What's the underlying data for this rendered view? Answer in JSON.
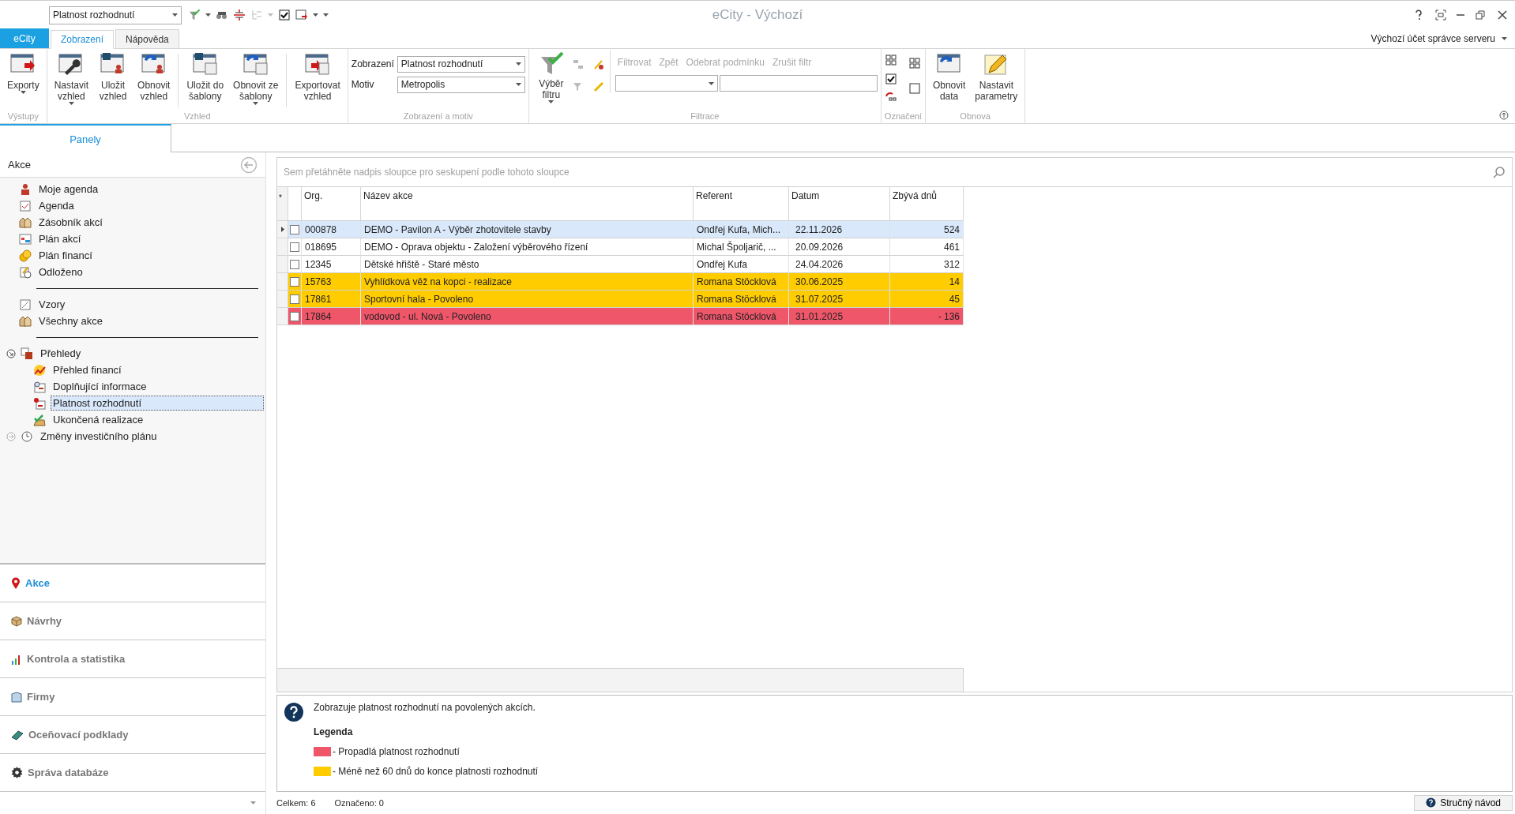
{
  "quick_access": {
    "view_select": "Platnost rozhodnutí"
  },
  "window": {
    "title": "eCity - Výchozí"
  },
  "ribbon_tabs": [
    {
      "label": "eCity",
      "kind": "app",
      "selected": false
    },
    {
      "label": "Zobrazení",
      "kind": "tab",
      "selected": true
    },
    {
      "label": "Nápověda",
      "kind": "tab",
      "selected": false
    }
  ],
  "account": {
    "label": "Výchozí účet správce serveru"
  },
  "ribbon_groups": [
    {
      "kind": "buttons",
      "label": "Výstupy",
      "buttons": [
        {
          "label": "Exporty",
          "dropdown": true
        }
      ]
    },
    {
      "kind": "buttons",
      "label": "Vzhled",
      "buttons": [
        {
          "label": "Nastavit\nvzhled",
          "dropdown": true
        },
        {
          "label": "Uložit\nvzhled",
          "dropdown": false
        },
        {
          "label": "Obnovit\nvzhled",
          "dropdown": false
        },
        {
          "label": "Uložit do\nšablony",
          "dropdown": false
        },
        {
          "label": "Obnovit ze\nšablony",
          "dropdown": true
        },
        {
          "label": "Exportovat\nvzhled",
          "dropdown": false
        }
      ]
    },
    {
      "kind": "combos",
      "label": "Zobrazení a motiv",
      "fields": [
        {
          "label": "Zobrazení",
          "value": "Platnost rozhodnutí"
        },
        {
          "label": "Motiv",
          "value": "Metropolis"
        }
      ]
    },
    {
      "kind": "filter",
      "label": "Filtrace",
      "button": {
        "label": "Výběr\nfiltru",
        "dropdown": true
      },
      "actions": [
        {
          "label": "Filtrovat",
          "disabled": true
        },
        {
          "label": "Zpět",
          "disabled": true
        },
        {
          "label": "Odebrat podmínku",
          "disabled": true
        },
        {
          "label": "Zrušit filtr",
          "disabled": true
        }
      ]
    },
    {
      "kind": "marks",
      "label": "Označení"
    },
    {
      "kind": "buttons",
      "label": "Obnova",
      "buttons": [
        {
          "label": "Obnovit\ndata",
          "dropdown": false
        },
        {
          "label": "Nastavit\nparametry",
          "dropdown": false
        }
      ]
    }
  ],
  "panels_tab": {
    "label": "Panely"
  },
  "section": {
    "title": "Akce"
  },
  "tree": [
    {
      "kind": "item",
      "label": "Moje agenda",
      "selected": false
    },
    {
      "kind": "item",
      "label": "Agenda",
      "selected": false
    },
    {
      "kind": "item",
      "label": "Zásobník akcí",
      "selected": false
    },
    {
      "kind": "item",
      "label": "Plán akcí",
      "selected": false
    },
    {
      "kind": "item",
      "label": "Plán financí",
      "selected": false
    },
    {
      "kind": "item",
      "label": "Odloženo",
      "selected": false
    },
    {
      "kind": "separator"
    },
    {
      "kind": "item",
      "label": "Vzory",
      "selected": false
    },
    {
      "kind": "item",
      "label": "Všechny akce",
      "selected": false
    },
    {
      "kind": "separator"
    },
    {
      "kind": "group",
      "label": "Přehledy",
      "selected": false,
      "expanded": true,
      "children": [
        {
          "kind": "item",
          "label": "Přehled financí",
          "selected": false
        },
        {
          "kind": "item",
          "label": "Doplňující informace",
          "selected": false
        },
        {
          "kind": "item",
          "label": "Platnost rozhodnutí",
          "selected": true
        },
        {
          "kind": "item",
          "label": "Ukončená realizace",
          "selected": false
        }
      ]
    },
    {
      "kind": "group",
      "label": "Změny investičního plánu",
      "selected": false,
      "expanded": false
    }
  ],
  "nav": [
    {
      "label": "Akce",
      "selected": true
    },
    {
      "label": "Návrhy",
      "selected": false
    },
    {
      "label": "Kontrola a statistika",
      "selected": false
    },
    {
      "label": "Firmy",
      "selected": false
    },
    {
      "label": "Oceňovací podklady",
      "selected": false
    },
    {
      "label": "Správa databáze",
      "selected": false
    }
  ],
  "grid": {
    "group_hint": "Sem přetáhněte nadpis sloupce pro seskupení podle tohoto sloupce",
    "new_row_mark": "*",
    "columns": [
      "Org.",
      "Název akce",
      "Referent",
      "Datum",
      "Zbývá dnů"
    ],
    "rows": [
      {
        "org": "000878",
        "name": "DEMO - Pavilon A - Výběr zhotovitele stavby",
        "referent": "Ondřej Kufa, Mich...",
        "date": "22.11.2026",
        "days": "524",
        "selected": true,
        "checked": false
      },
      {
        "org": "018695",
        "name": "DEMO - Oprava objektu - Založení výběrového řízení",
        "referent": "Michal Špoljarič, ...",
        "date": "20.09.2026",
        "days": "461",
        "selected": false,
        "checked": false
      },
      {
        "org": "12345",
        "name": "Dětské hřiště  - Staré město",
        "referent": "Ondřej Kufa",
        "date": "24.04.2026",
        "days": "312",
        "selected": false,
        "checked": false
      },
      {
        "org": "15763",
        "name": "Vyhlídková věž na kopci - realizace",
        "referent": "Romana Stöcklová",
        "date": "30.06.2025",
        "days": "14",
        "selected": false,
        "checked": false,
        "color": "#ffcc00"
      },
      {
        "org": "17861",
        "name": "Sportovní hala - Povoleno",
        "referent": "Romana Stöcklová",
        "date": "31.07.2025",
        "days": "45",
        "selected": false,
        "checked": false,
        "color": "#ffcc00"
      },
      {
        "org": "17864",
        "name": "vodovod - ul. Nová  - Povoleno",
        "referent": "Romana Stöcklová",
        "date": "31.01.2025",
        "days": "- 136",
        "selected": false,
        "checked": false,
        "color": "#f0566a"
      }
    ]
  },
  "help": {
    "description": "Zobrazuje platnost rozhodnutí na povolených akcích.",
    "legend_title": "Legenda",
    "legend": [
      {
        "color": "#f0566a",
        "label": "- Propadlá platnost rozhodnutí"
      },
      {
        "color": "#ffcc00",
        "label": "- Méně než 60 dnů do konce platnosti rozhodnutí"
      }
    ]
  },
  "status_bar": {
    "total": "Celkem: 6",
    "marked": "Označeno: 0",
    "help_button": "Stručný návod"
  }
}
